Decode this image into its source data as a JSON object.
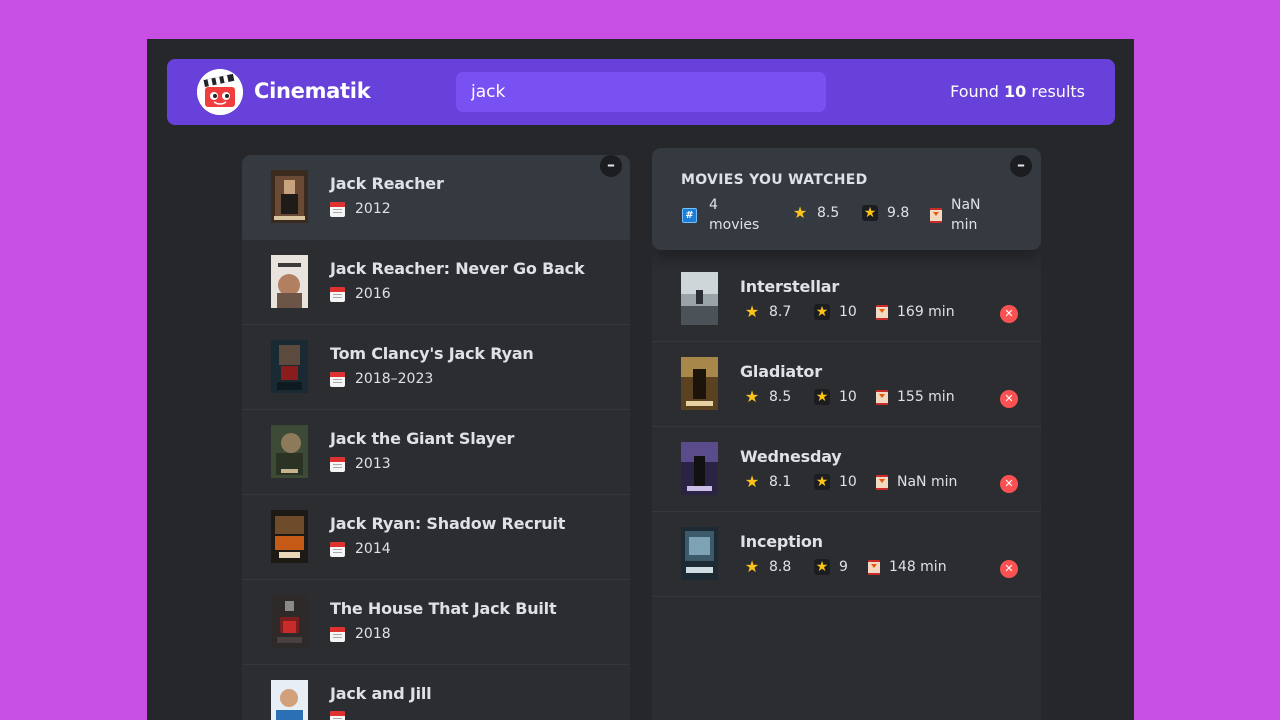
{
  "nav": {
    "brand": "Cinematik",
    "search_value": "jack",
    "found_prefix": "Found",
    "found_count": "10",
    "found_suffix": "results"
  },
  "toggle_label": "–",
  "movies": [
    {
      "title": "Jack Reacher",
      "year": "2012"
    },
    {
      "title": "Jack Reacher: Never Go Back",
      "year": "2016"
    },
    {
      "title": "Tom Clancy's Jack Ryan",
      "year": "2018–2023"
    },
    {
      "title": "Jack the Giant Slayer",
      "year": "2013"
    },
    {
      "title": "Jack Ryan: Shadow Recruit",
      "year": "2014"
    },
    {
      "title": "The House That Jack Built",
      "year": "2018"
    },
    {
      "title": "Jack and Jill",
      "year": ""
    }
  ],
  "summary": {
    "title": "MOVIES YOU WATCHED",
    "count_num": "4",
    "count_word": "movies",
    "avg_imdb": "8.5",
    "avg_user": "9.8",
    "runtime_num": "NaN",
    "runtime_unit": "min"
  },
  "watched": [
    {
      "title": "Interstellar",
      "imdb": "8.7",
      "user": "10",
      "runtime": "169 min"
    },
    {
      "title": "Gladiator",
      "imdb": "8.5",
      "user": "10",
      "runtime": "155 min"
    },
    {
      "title": "Wednesday",
      "imdb": "8.1",
      "user": "10",
      "runtime": "NaN min"
    },
    {
      "title": "Inception",
      "imdb": "8.8",
      "user": "9",
      "runtime": "148 min"
    }
  ],
  "delete_label": "✕",
  "colors": {
    "page_bg": "#c84fe3",
    "app_bg": "#25272b",
    "nav_bg": "#6741d9",
    "search_bg": "#7950f2",
    "panel_bg": "#2b2d31",
    "delete": "#fa5252",
    "star": "#fcc419"
  }
}
